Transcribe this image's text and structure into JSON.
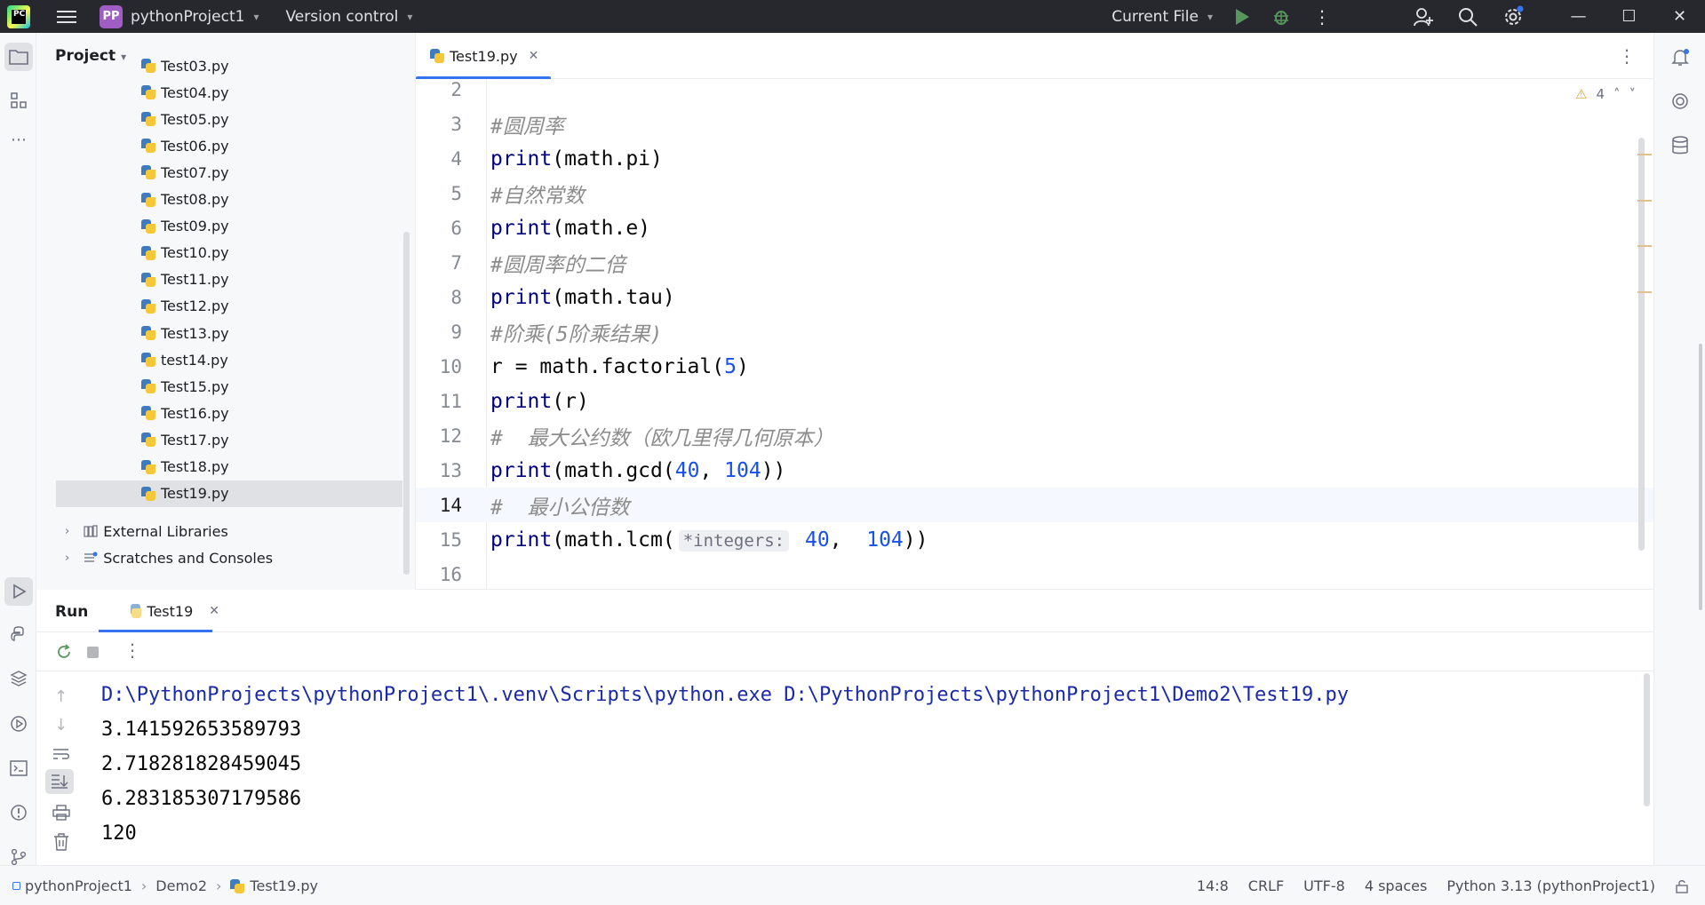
{
  "titlebar": {
    "project_badge": "PP",
    "project_name": "pythonProject1",
    "vcs_label": "Version control",
    "run_config": "Current File",
    "icons": [
      "pycharm-logo-icon",
      "hamburger-menu-icon",
      "chevron-down-icon",
      "run-icon",
      "debug-icon",
      "more-vertical-icon",
      "add-user-icon",
      "search-icon",
      "settings-icon",
      "minimize-icon",
      "maximize-icon",
      "close-icon"
    ]
  },
  "project_panel": {
    "title": "Project",
    "files": [
      "Test03.py",
      "Test04.py",
      "Test05.py",
      "Test06.py",
      "Test07.py",
      "Test08.py",
      "Test09.py",
      "Test10.py",
      "Test11.py",
      "Test12.py",
      "Test13.py",
      "test14.py",
      "Test15.py",
      "Test16.py",
      "Test17.py",
      "Test18.py",
      "Test19.py"
    ],
    "selected_file": "Test19.py",
    "external_libraries": "External Libraries",
    "scratches": "Scratches and Consoles"
  },
  "editor": {
    "tab_label": "Test19.py",
    "warning_count": "4",
    "lines": [
      {
        "n": "2",
        "text": ""
      },
      {
        "n": "3",
        "text": "#圆周率"
      },
      {
        "n": "4",
        "text": "print(math.pi)"
      },
      {
        "n": "5",
        "text": "#自然常数"
      },
      {
        "n": "6",
        "text": "print(math.e)"
      },
      {
        "n": "7",
        "text": "#圆周率的二倍"
      },
      {
        "n": "8",
        "text": "print(math.tau)"
      },
      {
        "n": "9",
        "text": "#阶乘(5阶乘结果)"
      },
      {
        "n": "10",
        "text": "r = math.factorial(5)"
      },
      {
        "n": "11",
        "text": "print(r)"
      },
      {
        "n": "12",
        "text": "#  最大公约数（欧几里得几何原本）"
      },
      {
        "n": "13",
        "text": "print(math.gcd(40, 104))"
      },
      {
        "n": "14",
        "text": "#  最小公倍数"
      },
      {
        "n": "15",
        "text": "print(math.lcm( *integers: 40,  104))"
      },
      {
        "n": "16",
        "text": ""
      }
    ],
    "current_line": "14",
    "param_hint": "*integers:"
  },
  "run_panel": {
    "title": "Run",
    "tab_label": "Test19",
    "output": [
      "D:\\PythonProjects\\pythonProject1\\.venv\\Scripts\\python.exe D:\\PythonProjects\\pythonProject1\\Demo2\\Test19.py",
      "3.141592653589793",
      "2.718281828459045",
      "6.283185307179586",
      "120"
    ]
  },
  "statusbar": {
    "crumbs": [
      "pythonProject1",
      "Demo2",
      "Test19.py"
    ],
    "caret": "14:8",
    "line_sep": "CRLF",
    "encoding": "UTF-8",
    "indent": "4 spaces",
    "interpreter": "Python 3.13 (pythonProject1)"
  },
  "colors": {
    "titlebar_bg": "#27282e",
    "accent": "#3574f0",
    "keyword": "#000080",
    "number": "#1750eb",
    "comment": "#8c8c8c",
    "run_green": "#57965c"
  }
}
